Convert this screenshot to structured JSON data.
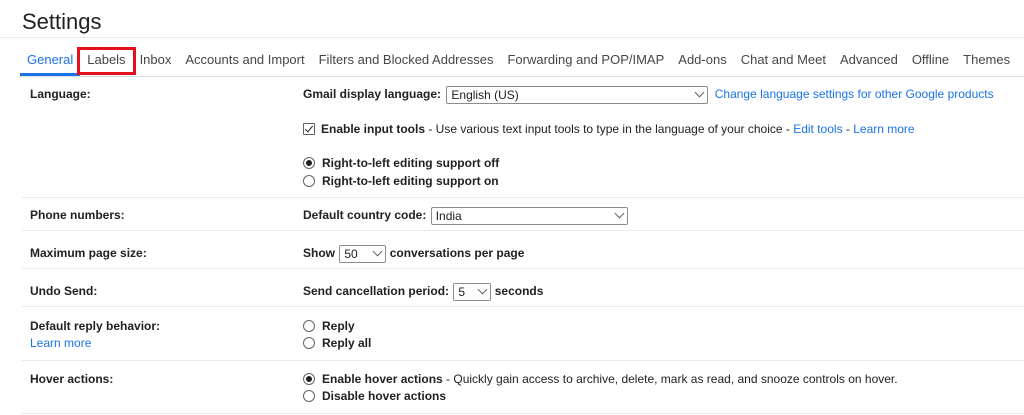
{
  "page": {
    "title": "Settings"
  },
  "tabs": [
    {
      "label": "General"
    },
    {
      "label": "Labels"
    },
    {
      "label": "Inbox"
    },
    {
      "label": "Accounts and Import"
    },
    {
      "label": "Filters and Blocked Addresses"
    },
    {
      "label": "Forwarding and POP/IMAP"
    },
    {
      "label": "Add-ons"
    },
    {
      "label": "Chat and Meet"
    },
    {
      "label": "Advanced"
    },
    {
      "label": "Offline"
    },
    {
      "label": "Themes"
    }
  ],
  "language": {
    "label": "Language:",
    "display_label": "Gmail display language:",
    "display_value": "English (US)",
    "change_link": "Change language settings for other Google products",
    "input_tools_label": "Enable input tools",
    "input_tools_desc": " - Use various text input tools to type in the language of your choice - ",
    "edit_tools_link": "Edit tools",
    "sep": " - ",
    "learn_more_link": "Learn more",
    "rtl_off": "Right-to-left editing support off",
    "rtl_on": "Right-to-left editing support on"
  },
  "phone": {
    "label": "Phone numbers:",
    "country_label": "Default country code:",
    "country_value": "India"
  },
  "page_size": {
    "label": "Maximum page size:",
    "show": "Show",
    "value": "50",
    "suffix": "conversations per page"
  },
  "undo": {
    "label": "Undo Send:",
    "period_label": "Send cancellation period:",
    "value": "5",
    "suffix": "seconds"
  },
  "reply": {
    "label": "Default reply behavior:",
    "learn_more": "Learn more",
    "opt_reply": "Reply",
    "opt_reply_all": "Reply all"
  },
  "hover": {
    "label": "Hover actions:",
    "enable": "Enable hover actions",
    "enable_desc": " - Quickly gain access to archive, delete, mark as read, and snooze controls on hover.",
    "disable": "Disable hover actions"
  }
}
